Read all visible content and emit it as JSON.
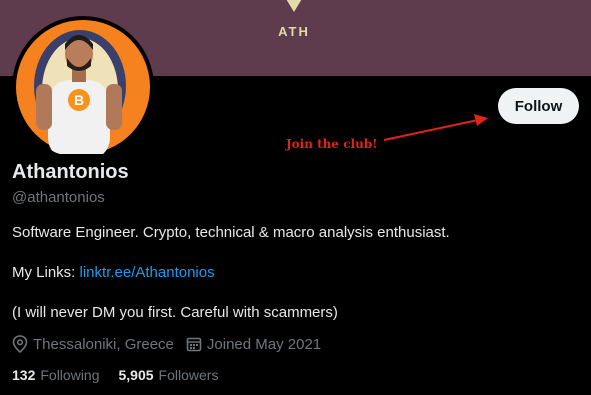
{
  "banner": {
    "text": "ATH"
  },
  "profile": {
    "name": "Athantonios",
    "handle": "@athantonios",
    "follow_label": "Follow",
    "bio_line1": "Software Engineer. Crypto, technical & macro analysis enthusiast.",
    "links_prefix": "My Links: ",
    "link_text": "linktr.ee/Athantonios",
    "bio_line3": "(I will never DM you first. Careful with scammers)",
    "location": "Thessaloniki, Greece",
    "joined": "Joined May 2021",
    "following_count": "132",
    "following_label": "Following",
    "followers_count": "5,905",
    "followers_label": "Followers"
  },
  "annotation": {
    "text": "Join the club!",
    "color": "#e0241b"
  },
  "colors": {
    "banner": "#5e3c4e",
    "accent_link": "#1d9bf0",
    "muted": "#71767b",
    "text": "#e7e9ea",
    "button_bg": "#eff3f4",
    "avatar_bg": "#f5821f"
  },
  "icons": [
    "location-pin-icon",
    "calendar-icon",
    "arrow-icon"
  ]
}
